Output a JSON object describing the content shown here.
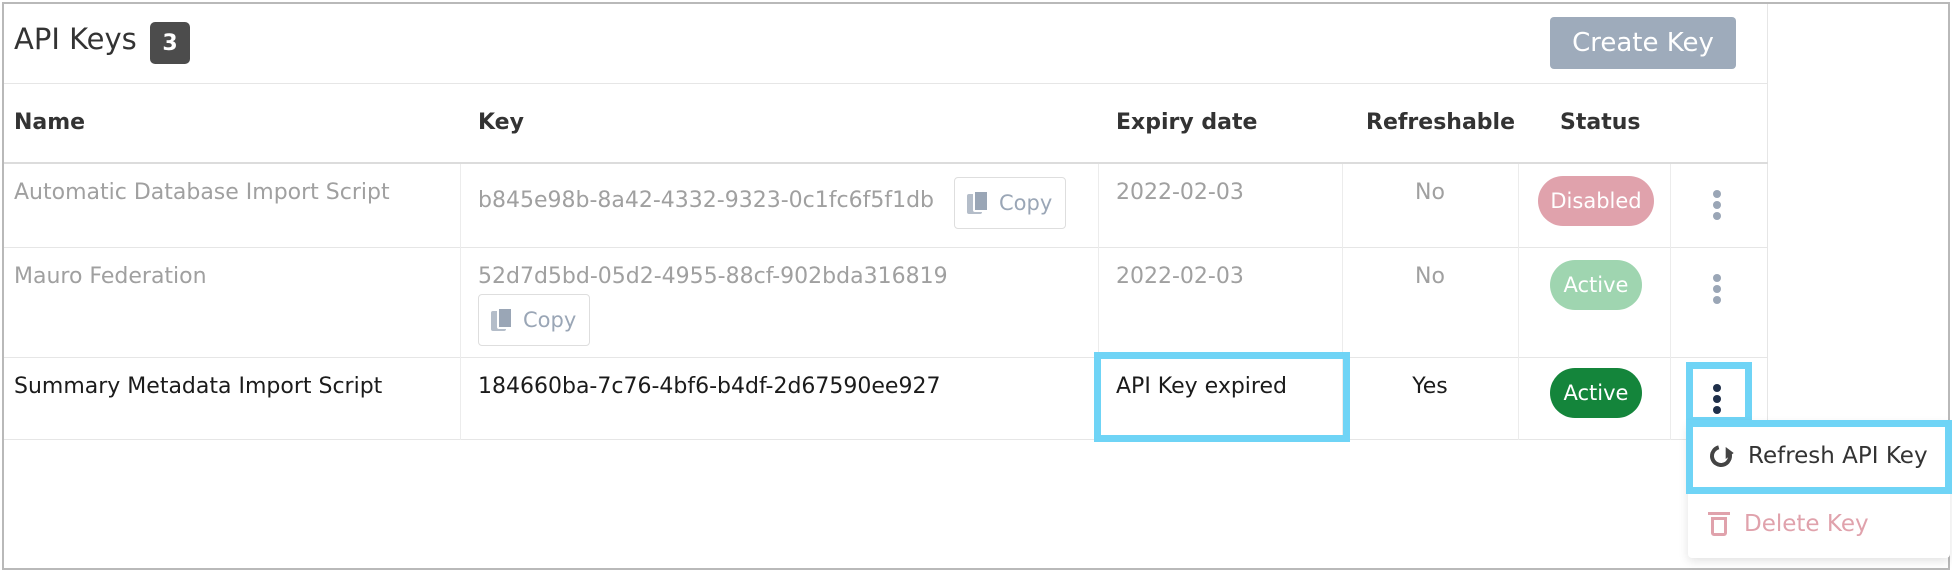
{
  "header": {
    "title": "API Keys",
    "count": "3",
    "create_label": "Create Key"
  },
  "table": {
    "columns": [
      "Name",
      "Key",
      "Expiry date",
      "Refreshable",
      "Status"
    ],
    "rows": [
      {
        "name": "Automatic Database Import Script",
        "key": "b845e98b-8a42-4332-9323-0c1fc6f5f1db",
        "copy_label": "Copy",
        "expiry": "2022-02-03",
        "refreshable": "No",
        "status": "Disabled"
      },
      {
        "name": "Mauro Federation",
        "key": "52d7d5bd-05d2-4955-88cf-902bda316819",
        "copy_label": "Copy",
        "expiry": "2022-02-03",
        "refreshable": "No",
        "status": "Active"
      },
      {
        "name": "Summary Metadata Import Script",
        "key": "184660ba-7c76-4bf6-b4df-2d67590ee927",
        "expiry": "API Key expired",
        "refreshable": "Yes",
        "status": "Active"
      }
    ]
  },
  "menu": {
    "items": [
      {
        "label": "Refresh API Key",
        "icon": "refresh-icon"
      },
      {
        "label": "Delete Key",
        "icon": "trash-icon"
      }
    ]
  },
  "colors": {
    "highlight": "#6fd4f6",
    "active": "#14853b",
    "disabled": "#e0a2ac",
    "button": "#9eabbb"
  }
}
